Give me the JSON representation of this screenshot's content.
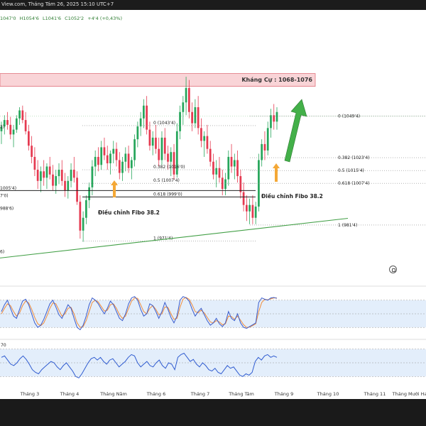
{
  "header": {
    "title": "View.com, Tháng Tám 26, 2025 15:10 UTC+7",
    "ohlc": {
      "open": "1047'0",
      "high": "H1054'6",
      "low": "L1041'6",
      "close": "C1052'2",
      "change": "+4'4 (+0,43%)"
    }
  },
  "chart_data": {
    "type": "candlestick",
    "x_labels": [
      "Tháng 3",
      "Tháng 4",
      "Tháng Năm",
      "Tháng 6",
      "Tháng 7",
      "Tháng Tám",
      "Tháng 9",
      "Tháng 10",
      "Tháng 11",
      "Tháng Mười Hai"
    ],
    "price_range": [
      950,
      1090
    ],
    "resistance_zone": {
      "label": "Kháng Cự : 1068-1076",
      "low": 1068,
      "high": 1076
    },
    "fib_left": {
      "levels": [
        {
          "label": "0 (1043'4)",
          "value": 1043.5
        },
        {
          "label": "0.382 (1016'0)",
          "value": 1016.0
        },
        {
          "label": "0.5 (1007'4)",
          "value": 1007.5
        },
        {
          "label": "0.618 (999'0)",
          "value": 999.0
        },
        {
          "label": "1 (971'4)",
          "value": 971.5
        }
      ],
      "annotation": "Điều chỉnh Fibo 38.2"
    },
    "fib_right": {
      "levels": [
        {
          "label": "0 (1049'4)",
          "value": 1049.5
        },
        {
          "label": "0.382 (1023'4)",
          "value": 1023.5
        },
        {
          "label": "0.5 (1015'4)",
          "value": 1015.5
        },
        {
          "label": "0.618 (1007'4)",
          "value": 1007.5
        },
        {
          "label": "1 (981'4)",
          "value": 981.5
        }
      ],
      "annotation": "Điều chỉnh Fibo 38.2"
    },
    "left_price_labels": [
      "2)",
      "1005'4)",
      "7'0)",
      "988'6)",
      "6)"
    ],
    "trendline": {
      "start": 968,
      "end": 987
    },
    "candles": [
      {
        "o": 1040,
        "h": 1046,
        "l": 1032,
        "c": 1043
      },
      {
        "o": 1043,
        "h": 1050,
        "l": 1038,
        "c": 1047
      },
      {
        "o": 1047,
        "h": 1052,
        "l": 1041,
        "c": 1044
      },
      {
        "o": 1044,
        "h": 1049,
        "l": 1035,
        "c": 1038
      },
      {
        "o": 1038,
        "h": 1044,
        "l": 1030,
        "c": 1041
      },
      {
        "o": 1041,
        "h": 1050,
        "l": 1039,
        "c": 1048
      },
      {
        "o": 1048,
        "h": 1055,
        "l": 1044,
        "c": 1053
      },
      {
        "o": 1053,
        "h": 1056,
        "l": 1045,
        "c": 1047
      },
      {
        "o": 1047,
        "h": 1052,
        "l": 1038,
        "c": 1040
      },
      {
        "o": 1040,
        "h": 1044,
        "l": 1028,
        "c": 1031
      },
      {
        "o": 1031,
        "h": 1037,
        "l": 1020,
        "c": 1024
      },
      {
        "o": 1024,
        "h": 1030,
        "l": 1012,
        "c": 1016
      },
      {
        "o": 1016,
        "h": 1022,
        "l": 1004,
        "c": 1009
      },
      {
        "o": 1009,
        "h": 1018,
        "l": 1002,
        "c": 1015
      },
      {
        "o": 1015,
        "h": 1022,
        "l": 1006,
        "c": 1011
      },
      {
        "o": 1011,
        "h": 1020,
        "l": 1004,
        "c": 1018
      },
      {
        "o": 1018,
        "h": 1024,
        "l": 1010,
        "c": 1013
      },
      {
        "o": 1013,
        "h": 1019,
        "l": 1003,
        "c": 1006
      },
      {
        "o": 1006,
        "h": 1016,
        "l": 1001,
        "c": 1012
      },
      {
        "o": 1012,
        "h": 1020,
        "l": 1007,
        "c": 1016
      },
      {
        "o": 1016,
        "h": 1022,
        "l": 1006,
        "c": 1009
      },
      {
        "o": 1009,
        "h": 1014,
        "l": 999,
        "c": 1003
      },
      {
        "o": 1003,
        "h": 1012,
        "l": 998,
        "c": 1009
      },
      {
        "o": 1009,
        "h": 1020,
        "l": 1005,
        "c": 1016
      },
      {
        "o": 1016,
        "h": 1024,
        "l": 1008,
        "c": 1011
      },
      {
        "o": 1011,
        "h": 1015,
        "l": 994,
        "c": 996
      },
      {
        "o": 996,
        "h": 1000,
        "l": 973,
        "c": 978
      },
      {
        "o": 978,
        "h": 990,
        "l": 971,
        "c": 986
      },
      {
        "o": 986,
        "h": 1000,
        "l": 982,
        "c": 997
      },
      {
        "o": 997,
        "h": 1008,
        "l": 992,
        "c": 1005
      },
      {
        "o": 1005,
        "h": 1022,
        "l": 1000,
        "c": 1018
      },
      {
        "o": 1018,
        "h": 1028,
        "l": 1012,
        "c": 1024
      },
      {
        "o": 1024,
        "h": 1030,
        "l": 1015,
        "c": 1019
      },
      {
        "o": 1019,
        "h": 1034,
        "l": 1016,
        "c": 1030
      },
      {
        "o": 1030,
        "h": 1036,
        "l": 1022,
        "c": 1025
      },
      {
        "o": 1025,
        "h": 1031,
        "l": 1016,
        "c": 1020
      },
      {
        "o": 1020,
        "h": 1028,
        "l": 1013,
        "c": 1026
      },
      {
        "o": 1026,
        "h": 1034,
        "l": 1020,
        "c": 1029
      },
      {
        "o": 1029,
        "h": 1033,
        "l": 1018,
        "c": 1022
      },
      {
        "o": 1022,
        "h": 1027,
        "l": 1010,
        "c": 1014
      },
      {
        "o": 1014,
        "h": 1024,
        "l": 1009,
        "c": 1021
      },
      {
        "o": 1021,
        "h": 1030,
        "l": 1015,
        "c": 1026
      },
      {
        "o": 1026,
        "h": 1031,
        "l": 1014,
        "c": 1017
      },
      {
        "o": 1017,
        "h": 1024,
        "l": 1010,
        "c": 1022
      },
      {
        "o": 1022,
        "h": 1038,
        "l": 1018,
        "c": 1035
      },
      {
        "o": 1035,
        "h": 1046,
        "l": 1030,
        "c": 1043
      },
      {
        "o": 1043,
        "h": 1052,
        "l": 1037,
        "c": 1048
      },
      {
        "o": 1048,
        "h": 1060,
        "l": 1042,
        "c": 1056
      },
      {
        "o": 1056,
        "h": 1062,
        "l": 1038,
        "c": 1041
      },
      {
        "o": 1041,
        "h": 1046,
        "l": 1028,
        "c": 1031
      },
      {
        "o": 1031,
        "h": 1040,
        "l": 1025,
        "c": 1036
      },
      {
        "o": 1036,
        "h": 1044,
        "l": 1026,
        "c": 1029
      },
      {
        "o": 1029,
        "h": 1036,
        "l": 1018,
        "c": 1022
      },
      {
        "o": 1022,
        "h": 1040,
        "l": 1019,
        "c": 1036
      },
      {
        "o": 1036,
        "h": 1042,
        "l": 1022,
        "c": 1026
      },
      {
        "o": 1026,
        "h": 1031,
        "l": 1016,
        "c": 1021
      },
      {
        "o": 1021,
        "h": 1030,
        "l": 1012,
        "c": 1027
      },
      {
        "o": 1027,
        "h": 1032,
        "l": 1010,
        "c": 1013
      },
      {
        "o": 1013,
        "h": 1045,
        "l": 1011,
        "c": 1040
      },
      {
        "o": 1040,
        "h": 1056,
        "l": 1035,
        "c": 1052
      },
      {
        "o": 1052,
        "h": 1062,
        "l": 1044,
        "c": 1058
      },
      {
        "o": 1058,
        "h": 1074,
        "l": 1050,
        "c": 1067
      },
      {
        "o": 1067,
        "h": 1072,
        "l": 1048,
        "c": 1052
      },
      {
        "o": 1052,
        "h": 1058,
        "l": 1040,
        "c": 1045
      },
      {
        "o": 1045,
        "h": 1060,
        "l": 1042,
        "c": 1055
      },
      {
        "o": 1055,
        "h": 1062,
        "l": 1038,
        "c": 1042
      },
      {
        "o": 1042,
        "h": 1048,
        "l": 1030,
        "c": 1034
      },
      {
        "o": 1034,
        "h": 1040,
        "l": 1024,
        "c": 1037
      },
      {
        "o": 1037,
        "h": 1044,
        "l": 1026,
        "c": 1029
      },
      {
        "o": 1029,
        "h": 1034,
        "l": 1018,
        "c": 1021
      },
      {
        "o": 1021,
        "h": 1026,
        "l": 1010,
        "c": 1013
      },
      {
        "o": 1013,
        "h": 1022,
        "l": 1005,
        "c": 1017
      },
      {
        "o": 1017,
        "h": 1024,
        "l": 1008,
        "c": 1011
      },
      {
        "o": 1011,
        "h": 1016,
        "l": 1000,
        "c": 1004
      },
      {
        "o": 1004,
        "h": 1014,
        "l": 1000,
        "c": 1010
      },
      {
        "o": 1010,
        "h": 1028,
        "l": 1006,
        "c": 1024
      },
      {
        "o": 1024,
        "h": 1032,
        "l": 1014,
        "c": 1018
      },
      {
        "o": 1018,
        "h": 1026,
        "l": 1010,
        "c": 1022
      },
      {
        "o": 1022,
        "h": 1028,
        "l": 1008,
        "c": 1012
      },
      {
        "o": 1012,
        "h": 1016,
        "l": 998,
        "c": 1002
      },
      {
        "o": 1002,
        "h": 1008,
        "l": 990,
        "c": 994
      },
      {
        "o": 994,
        "h": 1000,
        "l": 984,
        "c": 990
      },
      {
        "o": 990,
        "h": 998,
        "l": 982,
        "c": 994
      },
      {
        "o": 994,
        "h": 1000,
        "l": 982,
        "c": 986
      },
      {
        "o": 986,
        "h": 996,
        "l": 982,
        "c": 993
      },
      {
        "o": 993,
        "h": 1026,
        "l": 990,
        "c": 1022
      },
      {
        "o": 1022,
        "h": 1035,
        "l": 1018,
        "c": 1032
      },
      {
        "o": 1032,
        "h": 1040,
        "l": 1022,
        "c": 1028
      },
      {
        "o": 1028,
        "h": 1046,
        "l": 1025,
        "c": 1042
      },
      {
        "o": 1042,
        "h": 1054,
        "l": 1036,
        "c": 1050
      },
      {
        "o": 1050,
        "h": 1057,
        "l": 1041,
        "c": 1046
      },
      {
        "o": 1046,
        "h": 1055,
        "l": 1041,
        "c": 1052
      }
    ],
    "stochastic": {
      "k": [
        55,
        70,
        80,
        62,
        45,
        40,
        60,
        78,
        82,
        70,
        50,
        30,
        20,
        25,
        38,
        55,
        72,
        80,
        65,
        48,
        40,
        55,
        70,
        62,
        40,
        20,
        15,
        25,
        45,
        70,
        85,
        80,
        72,
        60,
        50,
        62,
        78,
        70,
        55,
        40,
        35,
        50,
        72,
        85,
        88,
        80,
        60,
        45,
        50,
        72,
        68,
        55,
        40,
        55,
        75,
        60,
        42,
        30,
        45,
        80,
        88,
        85,
        78,
        60,
        45,
        55,
        62,
        48,
        35,
        25,
        30,
        40,
        28,
        22,
        30,
        55,
        40,
        35,
        50,
        30,
        20,
        18,
        22,
        26,
        30,
        75,
        85,
        82,
        80,
        85,
        86,
        84
      ],
      "d": [
        50,
        62,
        72,
        68,
        55,
        45,
        52,
        68,
        78,
        74,
        60,
        42,
        28,
        24,
        30,
        45,
        62,
        74,
        72,
        58,
        45,
        50,
        62,
        64,
        50,
        30,
        20,
        22,
        35,
        55,
        75,
        80,
        76,
        66,
        56,
        58,
        70,
        72,
        62,
        48,
        40,
        45,
        62,
        78,
        85,
        84,
        70,
        55,
        50,
        62,
        68,
        60,
        48,
        50,
        65,
        64,
        50,
        38,
        40,
        65,
        82,
        86,
        82,
        70,
        55,
        52,
        58,
        52,
        42,
        32,
        30,
        35,
        32,
        26,
        28,
        45,
        44,
        38,
        45,
        36,
        26,
        20,
        21,
        24,
        28,
        55,
        75,
        82,
        81,
        83,
        85,
        85
      ]
    },
    "rsi": [
      58,
      60,
      54,
      48,
      46,
      50,
      56,
      60,
      55,
      48,
      40,
      36,
      34,
      40,
      44,
      48,
      52,
      50,
      44,
      40,
      46,
      50,
      44,
      38,
      30,
      28,
      34,
      42,
      50,
      56,
      58,
      54,
      58,
      52,
      48,
      54,
      56,
      50,
      44,
      48,
      52,
      58,
      62,
      60,
      50,
      44,
      48,
      52,
      46,
      44,
      50,
      54,
      46,
      42,
      50,
      48,
      40,
      58,
      62,
      64,
      58,
      52,
      55,
      48,
      44,
      50,
      46,
      40,
      38,
      42,
      36,
      34,
      40,
      46,
      42,
      44,
      38,
      32,
      30,
      34,
      32,
      36,
      52,
      58,
      54,
      60,
      62,
      58,
      60,
      58
    ]
  },
  "ui": {
    "left_annotation": "Điều chỉnh Fibo 38.2",
    "right_annotation": "Điều chỉnh Fibo 38.2",
    "stoch_label": "",
    "rsi_label": "70"
  }
}
